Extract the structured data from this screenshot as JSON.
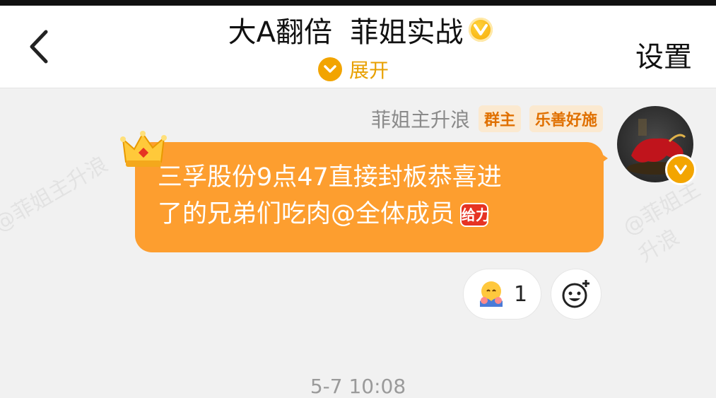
{
  "header": {
    "title": "大A翻倍  菲姐实战",
    "expand_label": "展开",
    "settings_label": "设置",
    "badge_icon": "v-badge-icon"
  },
  "watermark": "@菲姐主升浪",
  "message": {
    "sender_name": "菲姐主升浪",
    "tags": [
      "群主",
      "乐善好施"
    ],
    "text_line1": "三孚股份9点47直接封板恭喜进",
    "text_line2": "了的兄弟们吃肉@全体成员",
    "emoji_label": "给力",
    "reaction_count": "1",
    "bubble_color": "#fd9e2f",
    "accent_color": "#f2a400"
  },
  "timestamp": "5-7 10:08"
}
